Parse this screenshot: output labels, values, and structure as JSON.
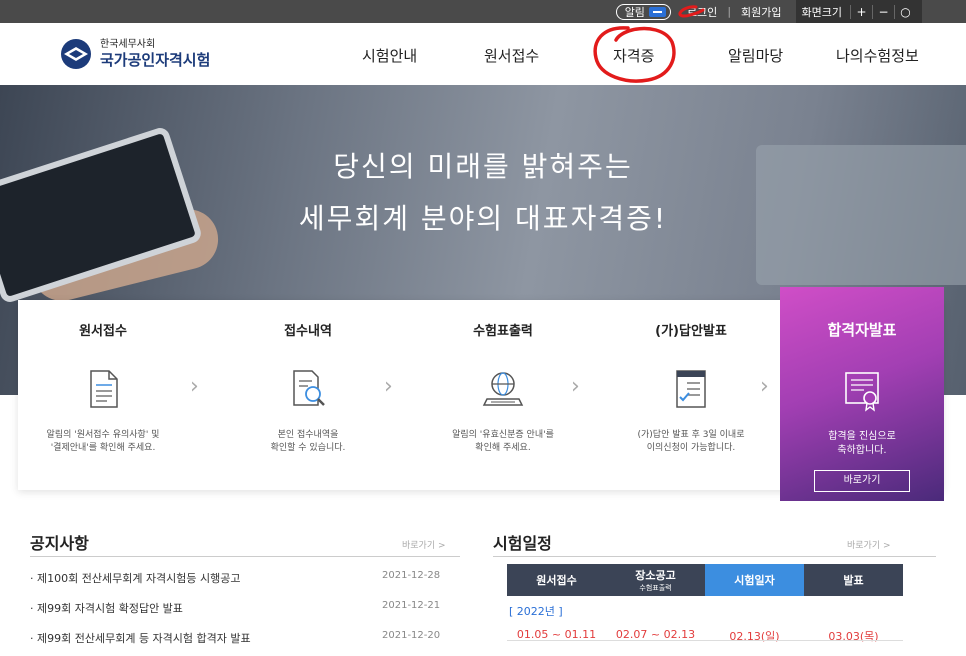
{
  "topbar": {
    "alarm_label": "알림",
    "login": "로그인",
    "separator": "|",
    "join": "회원가입",
    "font_size_label": "화면크기",
    "font_plus": "+",
    "font_minus": "−",
    "font_reset": "○"
  },
  "header": {
    "org_name": "한국세무사회",
    "site_name": "국가공인자격시험",
    "nav": [
      {
        "label": "시험안내"
      },
      {
        "label": "원서접수"
      },
      {
        "label": "자격증"
      },
      {
        "label": "알림마당"
      },
      {
        "label": "나의수험정보"
      }
    ]
  },
  "hero": {
    "line1": "당신의 미래를 밝혀주는",
    "line2": "세무회계 분야의 대표자격증!"
  },
  "steps": [
    {
      "title": "원서접수",
      "desc1": "알림의 '원서접수 유의사항' 및",
      "desc2": "'결제안내'를 확인해 주세요.",
      "icon": "document-icon"
    },
    {
      "title": "접수내역",
      "desc1": "본인 접수내역을",
      "desc2": "확인할 수 있습니다.",
      "icon": "search-document-icon"
    },
    {
      "title": "수험표출력",
      "desc1": "알림의 '유효신분증 안내'를",
      "desc2": "확인해 주세요.",
      "icon": "globe-laptop-icon"
    },
    {
      "title": "(가)답안발표",
      "desc1": "(가)답안 발표 후 3일 이내로",
      "desc2": "이의신청이 가능합니다.",
      "icon": "checklist-icon"
    }
  ],
  "pass": {
    "title": "합격자발표",
    "desc1": "합격을 진심으로",
    "desc2": "축하합니다.",
    "button": "바로가기",
    "icon": "certificate-icon"
  },
  "notice": {
    "title": "공지사항",
    "more": "바로가기 >",
    "items": [
      {
        "title": "· 제100회 전산세무회계 자격시험등 시행공고",
        "date": "2021-12-28"
      },
      {
        "title": "· 제99회 자격시험 확정답안 발표",
        "date": "2021-12-21"
      },
      {
        "title": "· 제99회 전산세무회계 등 자격시험 합격자 발표",
        "date": "2021-12-20"
      }
    ]
  },
  "schedule": {
    "title": "시험일정",
    "more": "바로가기 >",
    "headers": [
      {
        "label": "원서접수",
        "sub": ""
      },
      {
        "label": "장소공고",
        "sub": "수험표출력"
      },
      {
        "label": "시험일자",
        "sub": ""
      },
      {
        "label": "발표",
        "sub": ""
      }
    ],
    "year": "[ 2022년 ]",
    "rows": [
      [
        "01.05 ~ 01.11",
        "02.07 ~ 02.13",
        "02.13(일)",
        "03.03(목)"
      ]
    ]
  },
  "colors": {
    "nav_bar": "#4a4a4a",
    "brand_blue": "#1c3b7a",
    "accent_blue": "#3c8ee0",
    "schedule_red": "#e23c3c",
    "pass_purple": "#a23fb3",
    "annotation_red": "#e21b1b"
  }
}
